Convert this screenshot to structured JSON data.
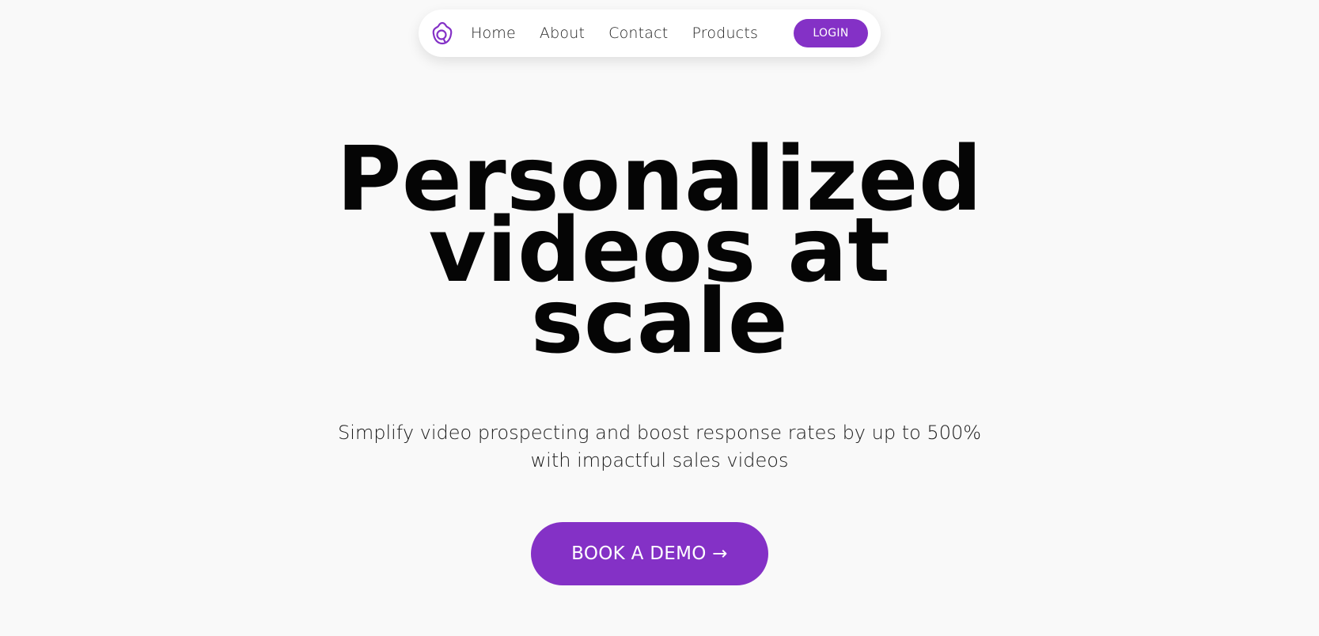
{
  "colors": {
    "accent": "#8431c6",
    "background": "#f9f9f9",
    "navbar": "#ffffff",
    "text": "#000000"
  },
  "nav": {
    "logo_icon": "brand-logo-icon",
    "links": [
      {
        "label": "Home"
      },
      {
        "label": "About"
      },
      {
        "label": "Contact"
      },
      {
        "label": "Products"
      }
    ],
    "login_label": "LOGIN"
  },
  "hero": {
    "title_lines": [
      "Personalized",
      "videos at",
      "scale"
    ],
    "subtitle_lines": [
      "Simplify video prospecting and boost response rates by up to 500%",
      "with impactful sales videos"
    ],
    "cta_label": "BOOK A DEMO →"
  }
}
